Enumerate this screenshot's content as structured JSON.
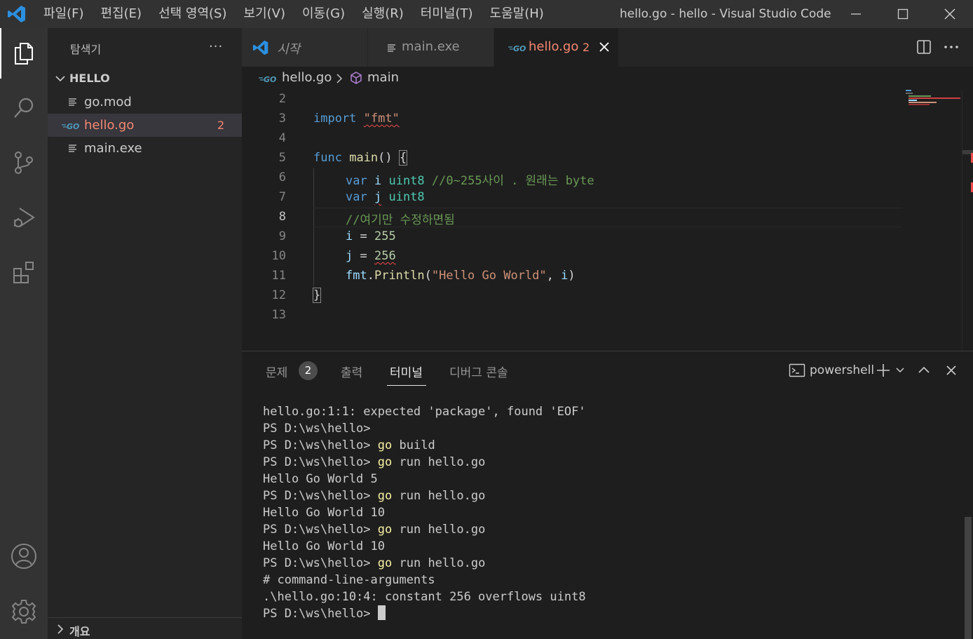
{
  "titlebar": {
    "menu": [
      "파일(F)",
      "편집(E)",
      "선택 영역(S)",
      "보기(V)",
      "이동(G)",
      "실행(R)",
      "터미널(T)",
      "도움말(H)"
    ],
    "window_title": "hello.go - hello - Visual Studio Code"
  },
  "activitybar": {
    "icons": [
      "explorer-icon",
      "search-icon",
      "source-control-icon",
      "run-debug-icon",
      "extensions-icon",
      "account-icon",
      "settings-gear-icon"
    ]
  },
  "sidebar": {
    "title": "탐색기",
    "more": "···",
    "folder": "HELLO",
    "files": [
      {
        "name": "go.mod",
        "icon": "file-lines-icon"
      },
      {
        "name": "hello.go",
        "icon": "go-file-icon",
        "problems": "2"
      },
      {
        "name": "main.exe",
        "icon": "file-lines-icon"
      }
    ],
    "outline": "개요"
  },
  "tabs": [
    {
      "label": "시작",
      "icon": "vscode-logo-icon"
    },
    {
      "label": "main.exe",
      "icon": "file-lines-icon"
    },
    {
      "label": "hello.go",
      "badge": "2",
      "icon": "go-file-icon"
    }
  ],
  "breadcrumb": {
    "file": "hello.go",
    "symbol": "main"
  },
  "editor": {
    "line_numbers": [
      "2",
      "3",
      "4",
      "5",
      "6",
      "7",
      "8",
      "9",
      "10",
      "11",
      "12",
      "13"
    ],
    "current_line": "8",
    "lines": {
      "l3_kw": "import",
      "l3_str": "\"fmt\"",
      "l5_kw": "func",
      "l5_fn": "main",
      "l5_rest": "() ",
      "l5_brace": "{",
      "l6_kw": "var",
      "l6_var": "i",
      "l6_type": "uint8",
      "l6_cmt": "//0~255사이 . 원래는 byte",
      "l7_kw": "var",
      "l7_var": "j",
      "l7_type": "uint8",
      "l8_cmt": "//여기만 수정하면됨",
      "l9_var": "i",
      "l9_op": " = ",
      "l9_num": "255",
      "l10_var": "j",
      "l10_op": " = ",
      "l10_num": "256",
      "l11_var": "fmt",
      "l11_dot": ".",
      "l11_fn": "Println",
      "l11_open": "(",
      "l11_str": "\"Hello Go World\"",
      "l11_comma": ", ",
      "l11_arg": "i",
      "l11_close": ")",
      "l12_brace": "}"
    }
  },
  "panel": {
    "tabs": {
      "problems": "문제",
      "problems_count": "2",
      "output": "출력",
      "terminal": "터미널",
      "debug_console": "디버그 콘솔"
    },
    "terminal_kind": "powershell",
    "terminal_lines": [
      {
        "text": "hello.go:1:1: expected 'package', found 'EOF'"
      },
      {
        "prompt": "PS D:\\ws\\hello>",
        "cmd": "",
        "args": ""
      },
      {
        "prompt": "PS D:\\ws\\hello>",
        "cmd": "go",
        "args": " build"
      },
      {
        "prompt": "PS D:\\ws\\hello>",
        "cmd": "go",
        "args": " run hello.go"
      },
      {
        "text": "Hello Go World 5"
      },
      {
        "prompt": "PS D:\\ws\\hello>",
        "cmd": "go",
        "args": " run hello.go"
      },
      {
        "text": "Hello Go World 10"
      },
      {
        "prompt": "PS D:\\ws\\hello>",
        "cmd": "go",
        "args": " run hello.go"
      },
      {
        "text": "Hello Go World 10"
      },
      {
        "prompt": "PS D:\\ws\\hello>",
        "cmd": "go",
        "args": " run hello.go"
      },
      {
        "text": "# command-line-arguments"
      },
      {
        "text": ".\\hello.go:10:4: constant 256 overflows uint8"
      },
      {
        "prompt": "PS D:\\ws\\hello>",
        "cmd": "",
        "args": " "
      }
    ]
  },
  "colors": {
    "accent": "#007acc",
    "error": "#f48771",
    "go": "#519aba"
  }
}
